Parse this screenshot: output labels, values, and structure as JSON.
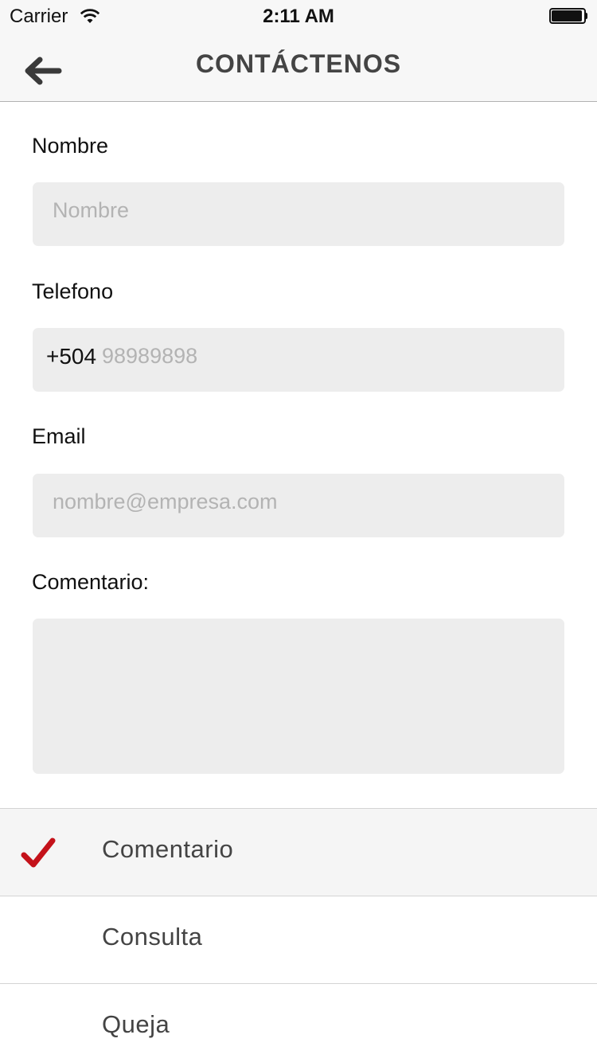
{
  "status_bar": {
    "carrier": "Carrier",
    "time": "2:11 AM",
    "icons": [
      "wifi-icon",
      "battery-icon"
    ]
  },
  "nav": {
    "title": "CONTÁCTENOS",
    "back_icon": "arrow-left-icon"
  },
  "form": {
    "name": {
      "label": "Nombre",
      "placeholder": "Nombre"
    },
    "phone": {
      "label": "Telefono",
      "prefix": "+504",
      "placeholder": "98989898"
    },
    "email": {
      "label": "Email",
      "placeholder": "nombre@empresa.com"
    },
    "comment": {
      "label": "Comentario:",
      "value": ""
    }
  },
  "options": [
    {
      "label": "Comentario",
      "selected": true
    },
    {
      "label": "Consulta",
      "selected": false
    },
    {
      "label": "Queja",
      "selected": false
    }
  ],
  "colors": {
    "accent": "#c4121a",
    "field_bg": "#ededed",
    "bar_bg": "#f7f7f7",
    "title": "#444444"
  }
}
